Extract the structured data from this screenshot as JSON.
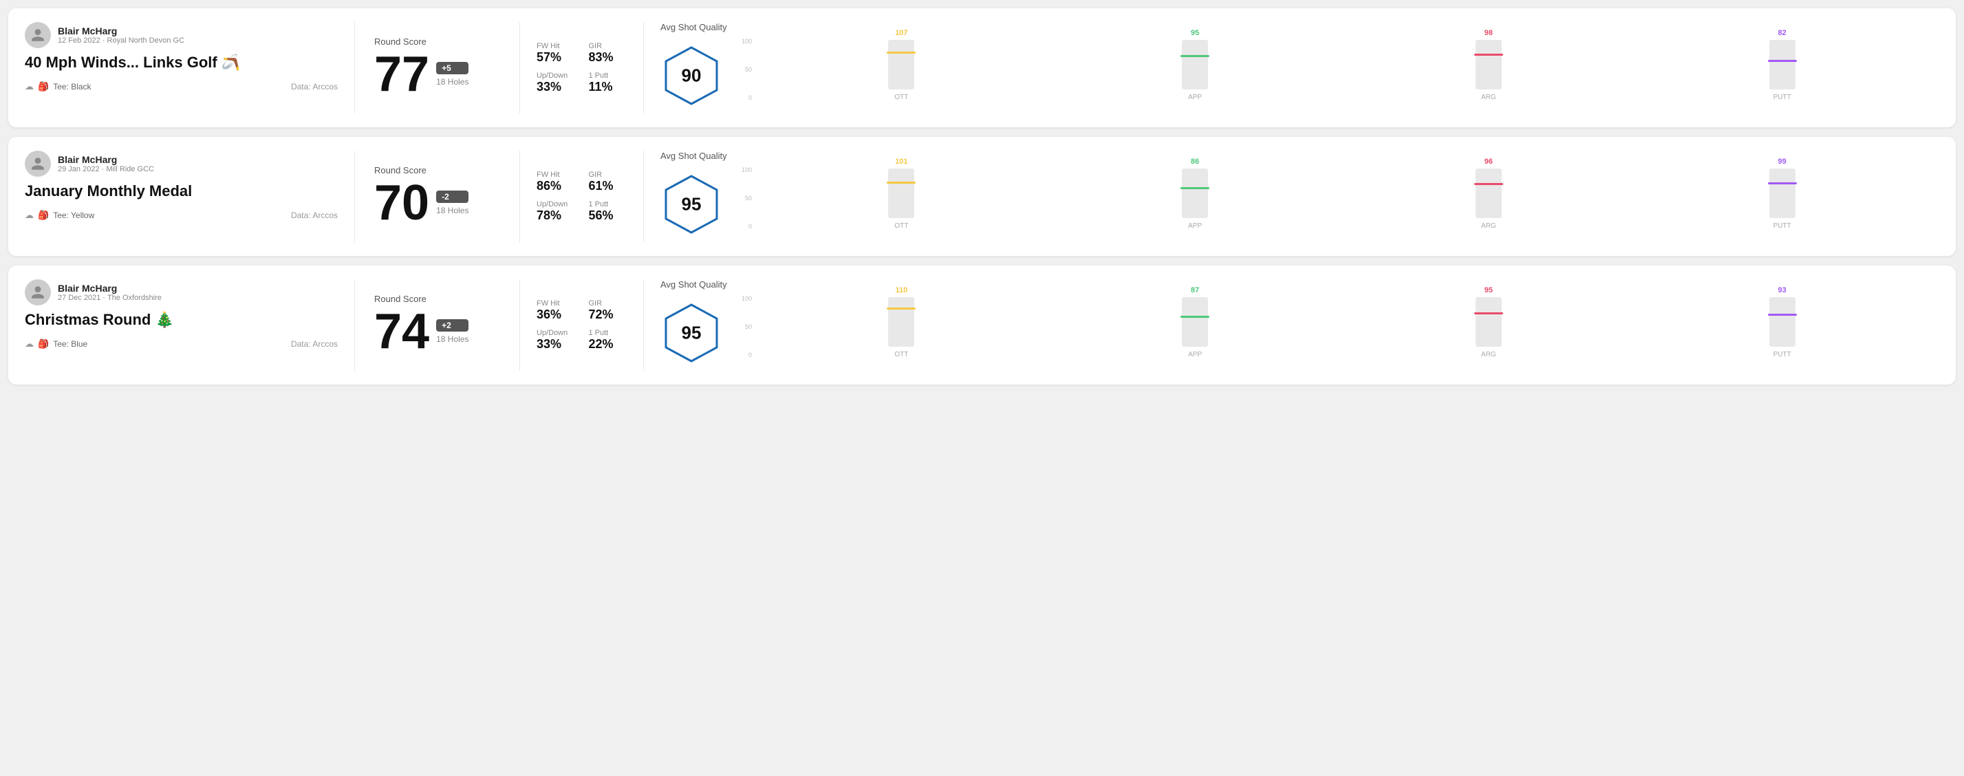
{
  "rounds": [
    {
      "id": "round-1",
      "user": {
        "name": "Blair McHarg",
        "date_course": "12 Feb 2022 · Royal North Devon GC"
      },
      "title": "40 Mph Winds... Links Golf 🪃",
      "tee": "Black",
      "data_source": "Data: Arccos",
      "score": {
        "label": "Round Score",
        "number": "77",
        "badge": "+5",
        "badge_type": "over",
        "holes": "18 Holes"
      },
      "stats": {
        "fw_hit_label": "FW Hit",
        "fw_hit_value": "57%",
        "gir_label": "GIR",
        "gir_value": "83%",
        "updown_label": "Up/Down",
        "updown_value": "33%",
        "oneputt_label": "1 Putt",
        "oneputt_value": "11%"
      },
      "quality": {
        "label": "Avg Shot Quality",
        "score": "90",
        "bars": [
          {
            "label": "OTT",
            "value": 107,
            "color": "#f5c842",
            "bar_pct": 72
          },
          {
            "label": "APP",
            "value": 95,
            "color": "#4dc97a",
            "bar_pct": 65
          },
          {
            "label": "ARG",
            "value": 98,
            "color": "#e84b6b",
            "bar_pct": 68
          },
          {
            "label": "PUTT",
            "value": 82,
            "color": "#a259f7",
            "bar_pct": 55
          }
        ]
      }
    },
    {
      "id": "round-2",
      "user": {
        "name": "Blair McHarg",
        "date_course": "29 Jan 2022 · Mill Ride GCC"
      },
      "title": "January Monthly Medal",
      "tee": "Yellow",
      "data_source": "Data: Arccos",
      "score": {
        "label": "Round Score",
        "number": "70",
        "badge": "-2",
        "badge_type": "under",
        "holes": "18 Holes"
      },
      "stats": {
        "fw_hit_label": "FW Hit",
        "fw_hit_value": "86%",
        "gir_label": "GIR",
        "gir_value": "61%",
        "updown_label": "Up/Down",
        "updown_value": "78%",
        "oneputt_label": "1 Putt",
        "oneputt_value": "56%"
      },
      "quality": {
        "label": "Avg Shot Quality",
        "score": "95",
        "bars": [
          {
            "label": "OTT",
            "value": 101,
            "color": "#f5c842",
            "bar_pct": 70
          },
          {
            "label": "APP",
            "value": 86,
            "color": "#4dc97a",
            "bar_pct": 58
          },
          {
            "label": "ARG",
            "value": 96,
            "color": "#e84b6b",
            "bar_pct": 66
          },
          {
            "label": "PUTT",
            "value": 99,
            "color": "#a259f7",
            "bar_pct": 68
          }
        ]
      }
    },
    {
      "id": "round-3",
      "user": {
        "name": "Blair McHarg",
        "date_course": "27 Dec 2021 · The Oxfordshire"
      },
      "title": "Christmas Round 🎄",
      "tee": "Blue",
      "data_source": "Data: Arccos",
      "score": {
        "label": "Round Score",
        "number": "74",
        "badge": "+2",
        "badge_type": "over",
        "holes": "18 Holes"
      },
      "stats": {
        "fw_hit_label": "FW Hit",
        "fw_hit_value": "36%",
        "gir_label": "GIR",
        "gir_value": "72%",
        "updown_label": "Up/Down",
        "updown_value": "33%",
        "oneputt_label": "1 Putt",
        "oneputt_value": "22%"
      },
      "quality": {
        "label": "Avg Shot Quality",
        "score": "95",
        "bars": [
          {
            "label": "OTT",
            "value": 110,
            "color": "#f5c842",
            "bar_pct": 75
          },
          {
            "label": "APP",
            "value": 87,
            "color": "#4dc97a",
            "bar_pct": 59
          },
          {
            "label": "ARG",
            "value": 95,
            "color": "#e84b6b",
            "bar_pct": 65
          },
          {
            "label": "PUTT",
            "value": 93,
            "color": "#a259f7",
            "bar_pct": 63
          }
        ]
      }
    }
  ],
  "y_axis_labels": [
    "100",
    "50",
    "0"
  ]
}
